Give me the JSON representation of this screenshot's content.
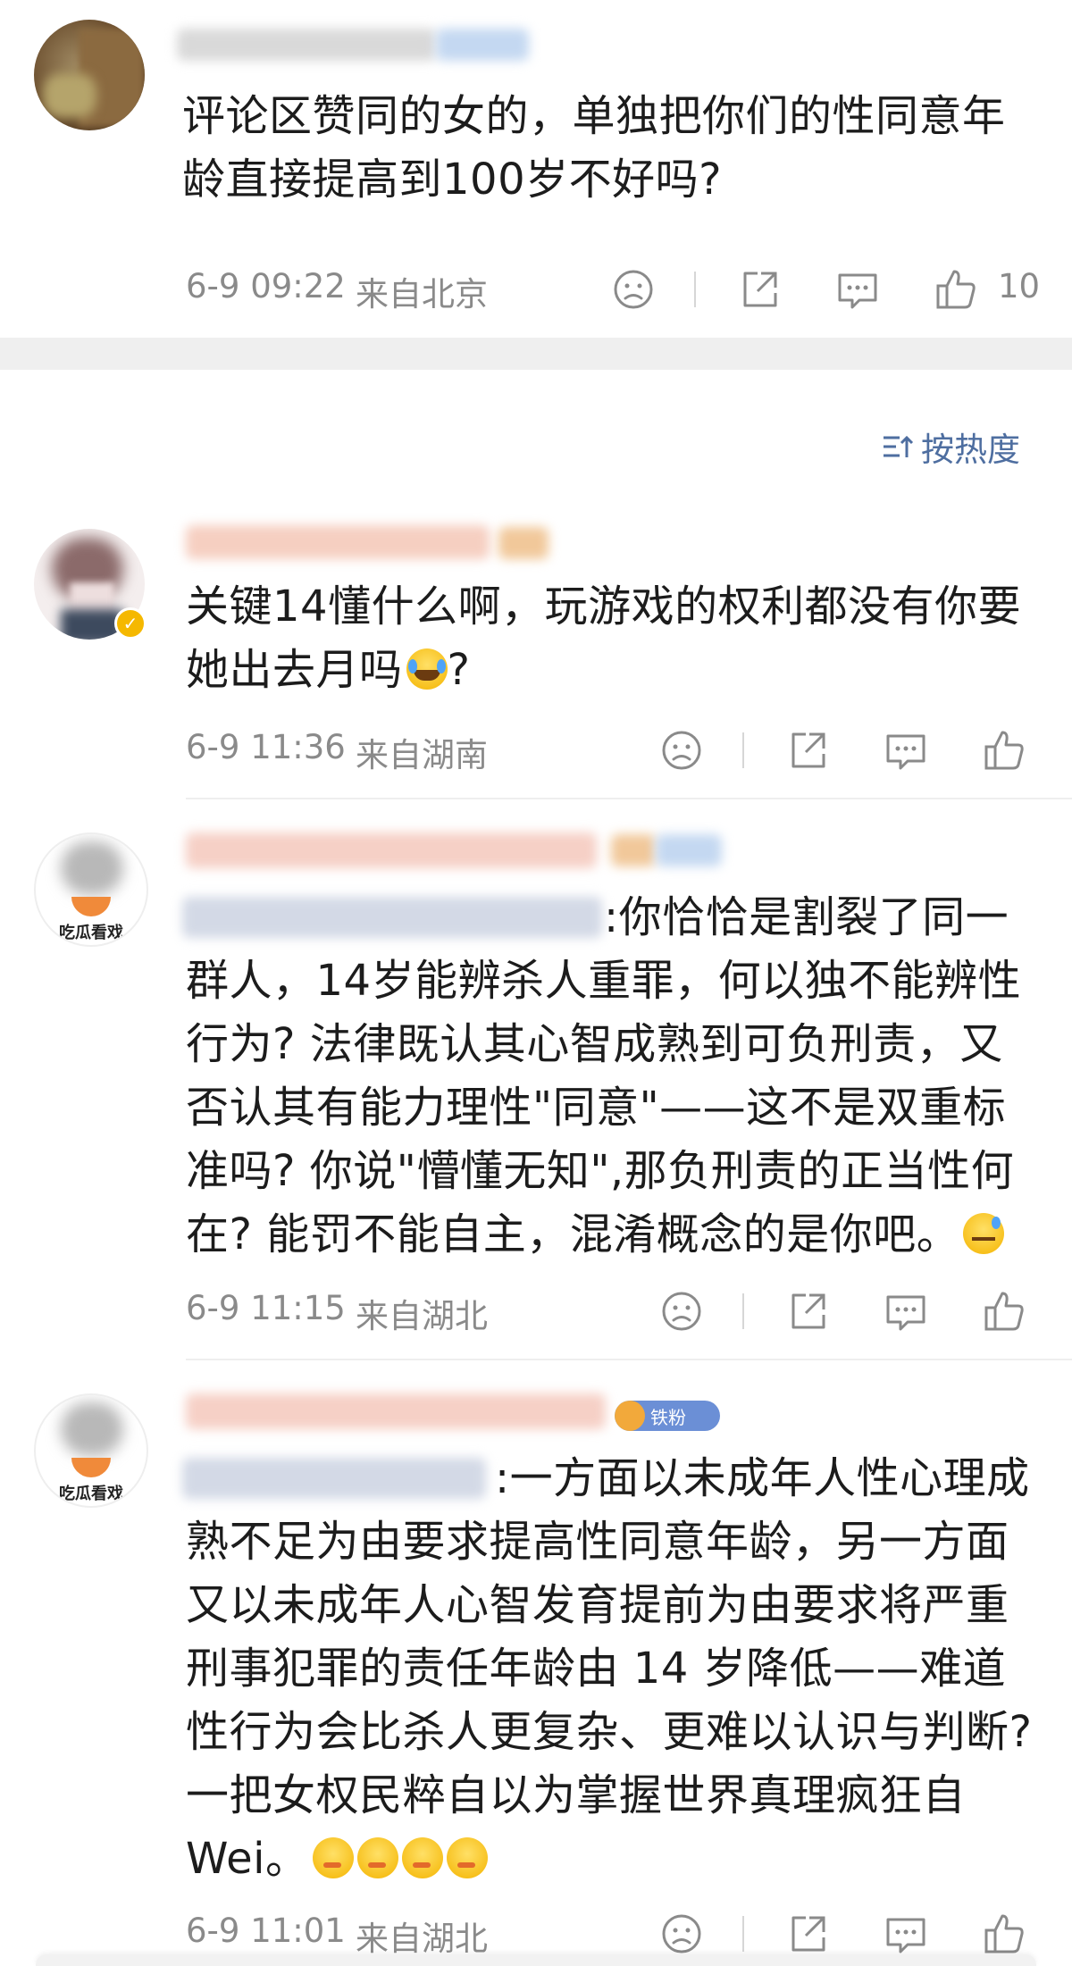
{
  "top_comment": {
    "text": "评论区赞同的女的，单独把你们的性同意年龄直接提高到100岁不好吗?",
    "time": "6-9 09:22",
    "location": "来自北京",
    "likes": "10"
  },
  "sort": {
    "label": "按热度",
    "icon": "sort-icon"
  },
  "comments": [
    {
      "text": "关键14懂什么啊，玩游戏的权利都没有你要她出去月吗",
      "suffix": "?",
      "emoji": "laughing-crying",
      "time": "6-9 11:36",
      "location": "来自湖南"
    },
    {
      "text": ":你恰恰是割裂了同一群人，14岁能辨杀人重罪，何以独不能辨性行为? 法律既认其心智成熟到可负刑责，又否认其有能力理性\"同意\"——这不是双重标准吗? 你说\"懵懂无知\",那负刑责的正当性何在? 能罚不能自主，混淆概念的是你吧。",
      "emoji": "sweat-smile",
      "time": "6-9 11:15",
      "location": "来自湖北",
      "avatar_label": "吃瓜看戏"
    },
    {
      "text": ":一方面以未成年人性心理成熟不足为由要求提高性同意年龄，另一方面又以未成年人心智发育提前为由要求将严重刑事犯罪的责任年龄由 14 岁降低——难道性行为会比杀人更复杂、更难以认识与判断? 一把女权民粹自以为掌握世界真理疯狂自Wei。",
      "emoji": "thinking x4",
      "time": "6-9 11:01",
      "location": "来自湖北",
      "avatar_label": "吃瓜看戏",
      "badge": "铁粉"
    }
  ],
  "colors": {
    "accent": "#4e6ea0",
    "meta_gray": "#8a8a8a",
    "divider": "#eeeeee",
    "section_gap": "#efefef"
  }
}
